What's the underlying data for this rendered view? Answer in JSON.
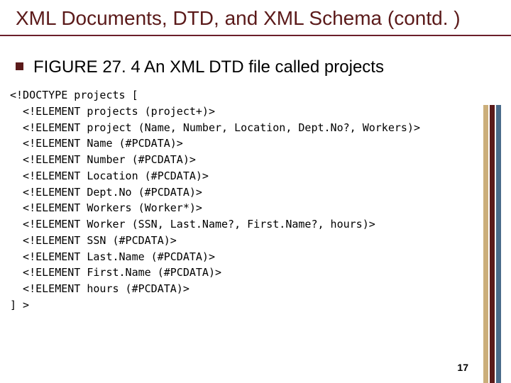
{
  "title": "XML Documents, DTD, and XML Schema (contd. )",
  "caption": "FIGURE 27. 4  An XML DTD file called projects",
  "code_lines": [
    "<!DOCTYPE projects [",
    "  <!ELEMENT projects (project+)>",
    "  <!ELEMENT project (Name, Number, Location, Dept.No?, Workers)>",
    "  <!ELEMENT Name (#PCDATA)>",
    "  <!ELEMENT Number (#PCDATA)>",
    "  <!ELEMENT Location (#PCDATA)>",
    "  <!ELEMENT Dept.No (#PCDATA)>",
    "  <!ELEMENT Workers (Worker*)>",
    "  <!ELEMENT Worker (SSN, Last.Name?, First.Name?, hours)>",
    "  <!ELEMENT SSN (#PCDATA)>",
    "  <!ELEMENT Last.Name (#PCDATA)>",
    "  <!ELEMENT First.Name (#PCDATA)>",
    "  <!ELEMENT hours (#PCDATA)>",
    "] >"
  ],
  "page_number": "17"
}
